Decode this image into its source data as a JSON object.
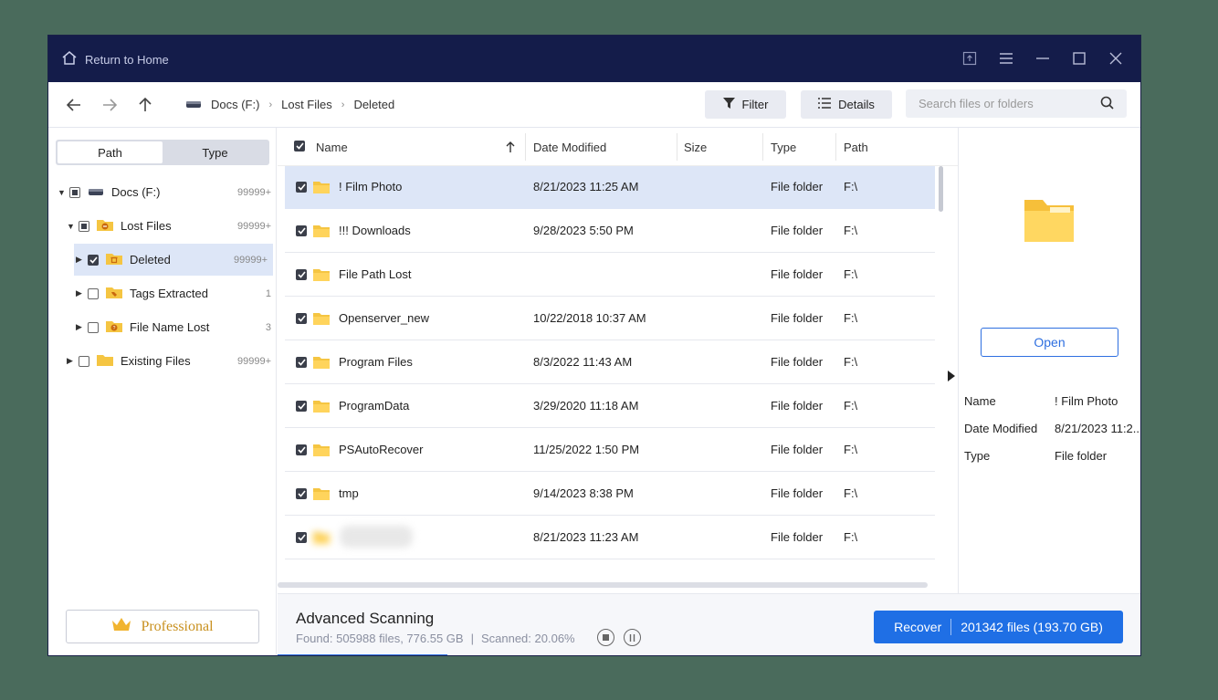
{
  "titlebar": {
    "home_label": "Return to Home"
  },
  "toolbar": {
    "breadcrumb": [
      "Docs (F:)",
      "Lost Files",
      "Deleted"
    ],
    "filter_label": "Filter",
    "details_label": "Details",
    "search_placeholder": "Search files or folders"
  },
  "sidebar": {
    "tabs": [
      "Path",
      "Type"
    ],
    "tree": [
      {
        "label": "Docs (F:)",
        "count": "99999+"
      },
      {
        "label": "Lost Files",
        "count": "99999+"
      },
      {
        "label": "Deleted",
        "count": "99999+"
      },
      {
        "label": "Tags Extracted",
        "count": "1"
      },
      {
        "label": "File Name Lost",
        "count": "3"
      },
      {
        "label": "Existing Files",
        "count": "99999+"
      }
    ],
    "pro_label": "Professional"
  },
  "table": {
    "headers": [
      "Name",
      "Date Modified",
      "Size",
      "Type",
      "Path"
    ],
    "rows": [
      {
        "name": "! Film Photo",
        "date": "8/21/2023 11:25 AM",
        "type": "File folder",
        "path": "F:\\"
      },
      {
        "name": "!!! Downloads",
        "date": "9/28/2023 5:50 PM",
        "type": "File folder",
        "path": "F:\\"
      },
      {
        "name": "File Path Lost",
        "date": "",
        "type": "File folder",
        "path": "F:\\"
      },
      {
        "name": "Openserver_new",
        "date": "10/22/2018 10:37 AM",
        "type": "File folder",
        "path": "F:\\"
      },
      {
        "name": "Program Files",
        "date": "8/3/2022 11:43 AM",
        "type": "File folder",
        "path": "F:\\"
      },
      {
        "name": "ProgramData",
        "date": "3/29/2020 11:18 AM",
        "type": "File folder",
        "path": "F:\\"
      },
      {
        "name": "PSAutoRecover",
        "date": "11/25/2022 1:50 PM",
        "type": "File folder",
        "path": "F:\\"
      },
      {
        "name": "tmp",
        "date": "9/14/2023 8:38 PM",
        "type": "File folder",
        "path": "F:\\"
      },
      {
        "name": "",
        "date": "8/21/2023 11:23 AM",
        "type": "File folder",
        "path": "F:\\"
      }
    ]
  },
  "preview": {
    "open_label": "Open",
    "props": [
      {
        "key": "Name",
        "value": "! Film Photo"
      },
      {
        "key": "Date Modified",
        "value": "8/21/2023 11:2.."
      },
      {
        "key": "Type",
        "value": "File folder"
      }
    ]
  },
  "status": {
    "title": "Advanced Scanning",
    "found": "Found: 505988 files, 776.55 GB",
    "divider": "|",
    "scanned": "Scanned: 20.06%",
    "scan_progress": 0.2006,
    "recover_label": "Recover",
    "recover_count": "201342 files (193.70 GB)"
  },
  "colors": {
    "titlebar": "#141c4a",
    "accent": "#1f6fe5",
    "selection": "#dde6f7",
    "folder": "#f5c542"
  }
}
